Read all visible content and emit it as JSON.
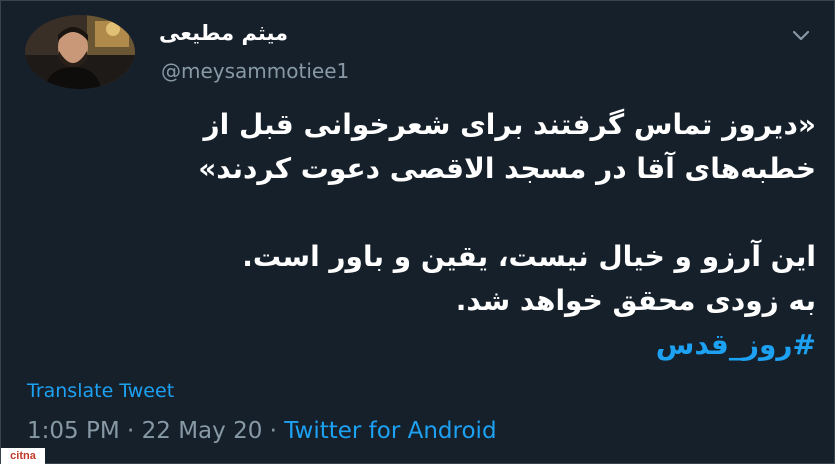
{
  "author": {
    "display_name": "میثم مطیعی",
    "handle": "@meysammotiee1",
    "avatar_icon": "profile-photo"
  },
  "menu": {
    "icon": "chevron-down-icon"
  },
  "tweet": {
    "lines": [
      "«دیروز تماس گرفتند برای شعرخوانی قبل از",
      "خطبه‌های آقا در مسجد الاقصی دعوت کردند»",
      "",
      "این آرزو و خیال نیست، یقین و باور است.",
      "به زودی محقق خواهد شد."
    ],
    "hashtag": "#روز_قدس"
  },
  "translate_label": "Translate Tweet",
  "meta": {
    "time": "1:05 PM",
    "separator": " · ",
    "date": "22 May 20",
    "source": "Twitter for Android"
  },
  "watermark": "citna",
  "colors": {
    "background": "#15202b",
    "link": "#1da1f2",
    "secondary_text": "#8899a6"
  }
}
